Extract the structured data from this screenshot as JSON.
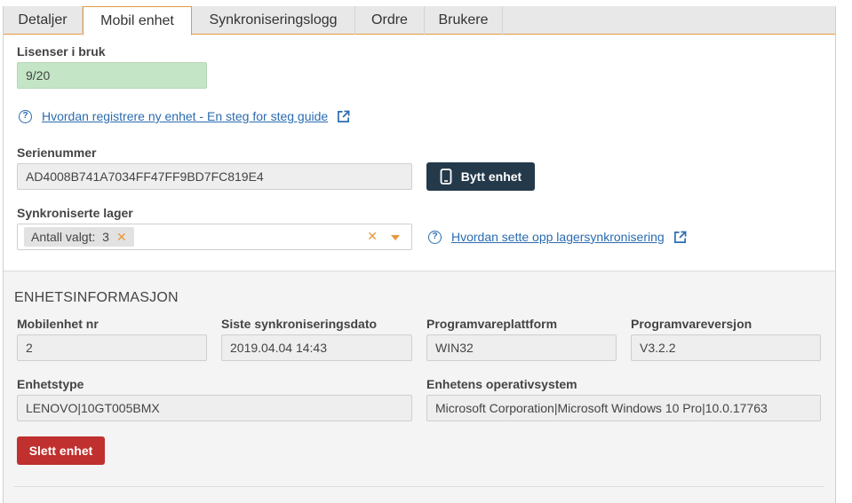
{
  "tabs": [
    {
      "label": "Detaljer"
    },
    {
      "label": "Mobil enhet"
    },
    {
      "label": "Synkroniseringslogg"
    },
    {
      "label": "Ordre"
    },
    {
      "label": "Brukere"
    }
  ],
  "licenses": {
    "label": "Lisenser i bruk",
    "value": "9/20"
  },
  "guide_link": {
    "text": "Hvordan registrere ny enhet - En steg for steg guide"
  },
  "serial": {
    "label": "Serienummer",
    "value": "AD4008B741A7034FF47FF9BD7FC819E4"
  },
  "swap_button": {
    "label": "Bytt enhet"
  },
  "synced_stock": {
    "label": "Synkroniserte lager",
    "chip": "Antall valgt:  3"
  },
  "stock_link": {
    "text": "Hvordan sette opp lagersynkronisering"
  },
  "device_info": {
    "title": "ENHETSINFORMASJON",
    "mobile_nr": {
      "label": "Mobilenhet nr",
      "value": "2"
    },
    "last_sync": {
      "label": "Siste synkroniseringsdato",
      "value": "2019.04.04 14:43"
    },
    "platform": {
      "label": "Programvareplattform",
      "value": "WIN32"
    },
    "version": {
      "label": "Programvareversjon",
      "value": "V3.2.2"
    },
    "device_type": {
      "label": "Enhetstype",
      "value": "LENOVO|10GT005BMX"
    },
    "os": {
      "label": "Enhetens operativsystem",
      "value": "Microsoft Corporation|Microsoft Windows 10 Pro|10.0.17763"
    }
  },
  "delete_button": {
    "label": "Slett enhet"
  },
  "colors": {
    "accent": "#e59a3c",
    "link": "#2b6cb0",
    "dark_button": "#24394a",
    "danger": "#c0302e",
    "license_ok": "#c4e6c6"
  }
}
